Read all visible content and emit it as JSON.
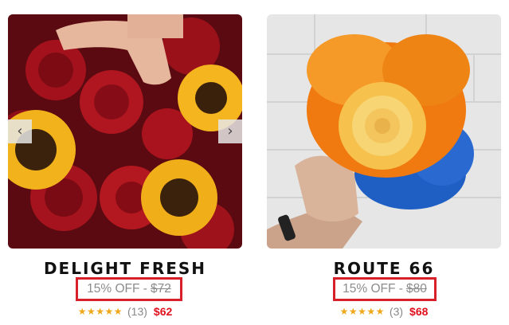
{
  "products": [
    {
      "name": "DELIGHT FRESH",
      "offer_label": "15% OFF -",
      "old_price": "$72",
      "stars": "★★★★★",
      "review_count": "(13)",
      "price": "$62",
      "prev_icon": "chevron-left-icon",
      "next_icon": "chevron-right-icon"
    },
    {
      "name": "ROUTE 66",
      "offer_label": "15% OFF -",
      "old_price": "$80",
      "stars": "★★★★★",
      "review_count": "(3)",
      "price": "$68"
    }
  ],
  "colors": {
    "highlight_border": "#d8202a",
    "sale_price": "#e0101d",
    "star": "#f0a81b",
    "muted_text": "#8c8c8c"
  },
  "arrows": {
    "prev": "‹",
    "next": "›"
  }
}
